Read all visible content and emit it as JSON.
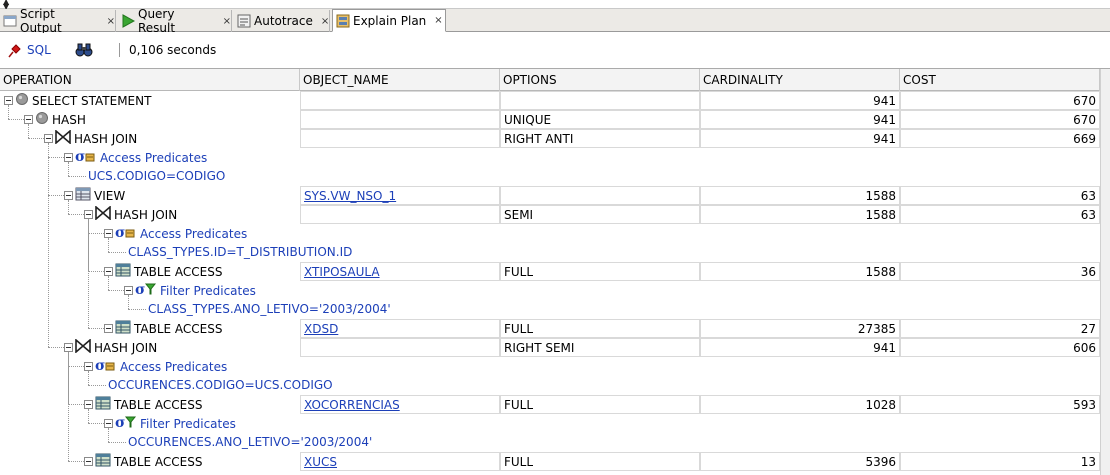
{
  "tabs": [
    {
      "label": "Script Output",
      "icon": "script-output-icon",
      "active": false
    },
    {
      "label": "Query Result",
      "icon": "play-icon",
      "active": false
    },
    {
      "label": "Autotrace",
      "icon": "autotrace-icon",
      "active": false
    },
    {
      "label": "Explain Plan",
      "icon": "explain-plan-icon",
      "active": true
    }
  ],
  "close_glyph": "×",
  "toolbar": {
    "sql_label": "SQL",
    "timing": "0,106 seconds"
  },
  "columns": [
    "OPERATION",
    "OBJECT_NAME",
    "OPTIONS",
    "CARDINALITY",
    "COST"
  ],
  "rows": [
    {
      "depth": 0,
      "kind": "select",
      "label": "SELECT STATEMENT",
      "object": "",
      "options": "",
      "cardinality": "941",
      "cost": "670"
    },
    {
      "depth": 1,
      "kind": "hash",
      "label": "HASH",
      "object": "",
      "options": "UNIQUE",
      "cardinality": "941",
      "cost": "670"
    },
    {
      "depth": 2,
      "kind": "join",
      "label": "HASH JOIN",
      "object": "",
      "options": "RIGHT ANTI",
      "cardinality": "941",
      "cost": "669"
    },
    {
      "depth": 3,
      "kind": "access",
      "label": "Access Predicates"
    },
    {
      "depth": 4,
      "kind": "predtext",
      "label": "UCS.CODIGO=CODIGO"
    },
    {
      "depth": 3,
      "kind": "view",
      "label": "VIEW",
      "object": "SYS.VW_NSO_1",
      "options": "",
      "cardinality": "1588",
      "cost": "63"
    },
    {
      "depth": 4,
      "kind": "join",
      "label": "HASH JOIN",
      "object": "",
      "options": "SEMI",
      "cardinality": "1588",
      "cost": "63"
    },
    {
      "depth": 5,
      "kind": "access",
      "label": "Access Predicates"
    },
    {
      "depth": 6,
      "kind": "predtext",
      "label": "CLASS_TYPES.ID=T_DISTRIBUTION.ID"
    },
    {
      "depth": 5,
      "kind": "table",
      "label": "TABLE ACCESS",
      "object": "XTIPOSAULA",
      "options": "FULL",
      "cardinality": "1588",
      "cost": "36"
    },
    {
      "depth": 6,
      "kind": "filter",
      "label": "Filter Predicates"
    },
    {
      "depth": 7,
      "kind": "predtext",
      "label": "CLASS_TYPES.ANO_LETIVO='2003/2004'"
    },
    {
      "depth": 5,
      "kind": "table",
      "label": "TABLE ACCESS",
      "object": "XDSD",
      "options": "FULL",
      "cardinality": "27385",
      "cost": "27"
    },
    {
      "depth": 3,
      "kind": "join",
      "label": "HASH JOIN",
      "object": "",
      "options": "RIGHT SEMI",
      "cardinality": "941",
      "cost": "606"
    },
    {
      "depth": 4,
      "kind": "access",
      "label": "Access Predicates"
    },
    {
      "depth": 5,
      "kind": "predtext",
      "label": "OCCURENCES.CODIGO=UCS.CODIGO"
    },
    {
      "depth": 4,
      "kind": "table",
      "label": "TABLE ACCESS",
      "object": "XOCORRENCIAS",
      "options": "FULL",
      "cardinality": "1028",
      "cost": "593"
    },
    {
      "depth": 5,
      "kind": "filter",
      "label": "Filter Predicates"
    },
    {
      "depth": 6,
      "kind": "predtext",
      "label": "OCCURENCES.ANO_LETIVO='2003/2004'"
    },
    {
      "depth": 4,
      "kind": "table",
      "label": "TABLE ACCESS",
      "object": "XUCS",
      "options": "FULL",
      "cardinality": "5396",
      "cost": "13"
    }
  ]
}
